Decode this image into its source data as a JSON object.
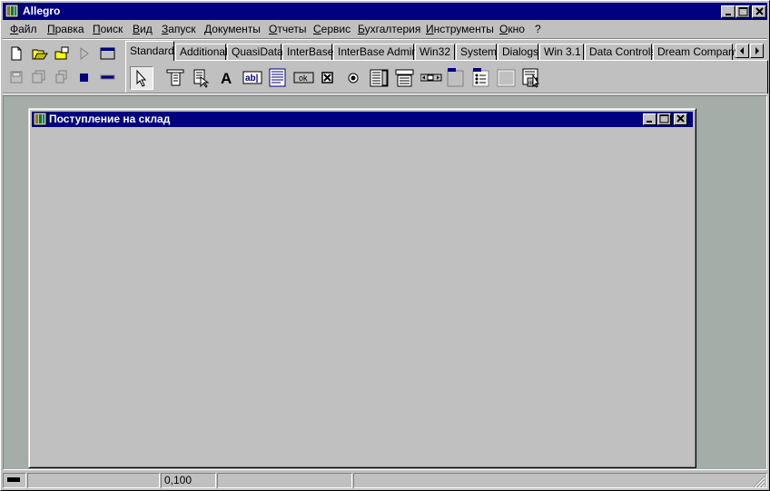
{
  "window": {
    "title": "Allegro"
  },
  "menu": [
    {
      "label": "Файл",
      "u": "Ф",
      "rest": "айл"
    },
    {
      "label": "Правка",
      "u": "П",
      "rest": "равка"
    },
    {
      "label": "Поиск",
      "u": "П",
      "rest": "оиск"
    },
    {
      "label": "Вид",
      "u": "В",
      "rest": "ид"
    },
    {
      "label": "Запуск",
      "u": "З",
      "rest": "апуск"
    },
    {
      "label": "Документы",
      "u": "Д",
      "rest": "окументы"
    },
    {
      "label": "Отчеты",
      "u": "О",
      "rest": "тчеты"
    },
    {
      "label": "Сервис",
      "u": "С",
      "rest": "ервис"
    },
    {
      "label": "Бухгалтерия",
      "u": "Б",
      "rest": "ухгалтерия"
    },
    {
      "label": "Инструменты",
      "u": "И",
      "rest": "нструменты"
    },
    {
      "label": "Окно",
      "u": "О",
      "rest": "кно"
    },
    {
      "label": "?",
      "u": "",
      "rest": "?"
    }
  ],
  "palette": {
    "tabs": [
      "Standard",
      "Additional",
      "QuasiData",
      "InterBase",
      "InterBase Admin",
      "Win32",
      "System",
      "Dialogs",
      "Win 3.1",
      "Data Controls",
      "Dream Company"
    ],
    "active_tab": "Standard",
    "components": [
      {
        "name": "pointer",
        "icon": "arrow-pointer-icon"
      },
      {
        "name": "mainmenu",
        "icon": "mainmenu-icon"
      },
      {
        "name": "popupmenu",
        "icon": "popupmenu-icon"
      },
      {
        "name": "label",
        "icon": "label-icon",
        "glyph": "A"
      },
      {
        "name": "edit",
        "icon": "edit-icon",
        "glyph": "ab|"
      },
      {
        "name": "memo",
        "icon": "memo-icon"
      },
      {
        "name": "button",
        "icon": "button-icon",
        "glyph": "ok"
      },
      {
        "name": "checkbox",
        "icon": "checkbox-icon"
      },
      {
        "name": "radiobutton",
        "icon": "radiobutton-icon"
      },
      {
        "name": "listbox",
        "icon": "listbox-icon"
      },
      {
        "name": "combobox",
        "icon": "combobox-icon"
      },
      {
        "name": "scrollbar",
        "icon": "scrollbar-icon"
      },
      {
        "name": "groupbox",
        "icon": "groupbox-icon"
      },
      {
        "name": "radiogroup",
        "icon": "radiogroup-icon"
      },
      {
        "name": "panel",
        "icon": "panel-icon"
      },
      {
        "name": "actionlist",
        "icon": "actionlist-icon"
      }
    ]
  },
  "child_window": {
    "title": "Поступление на склад"
  },
  "status": {
    "panel2": "0,100"
  }
}
